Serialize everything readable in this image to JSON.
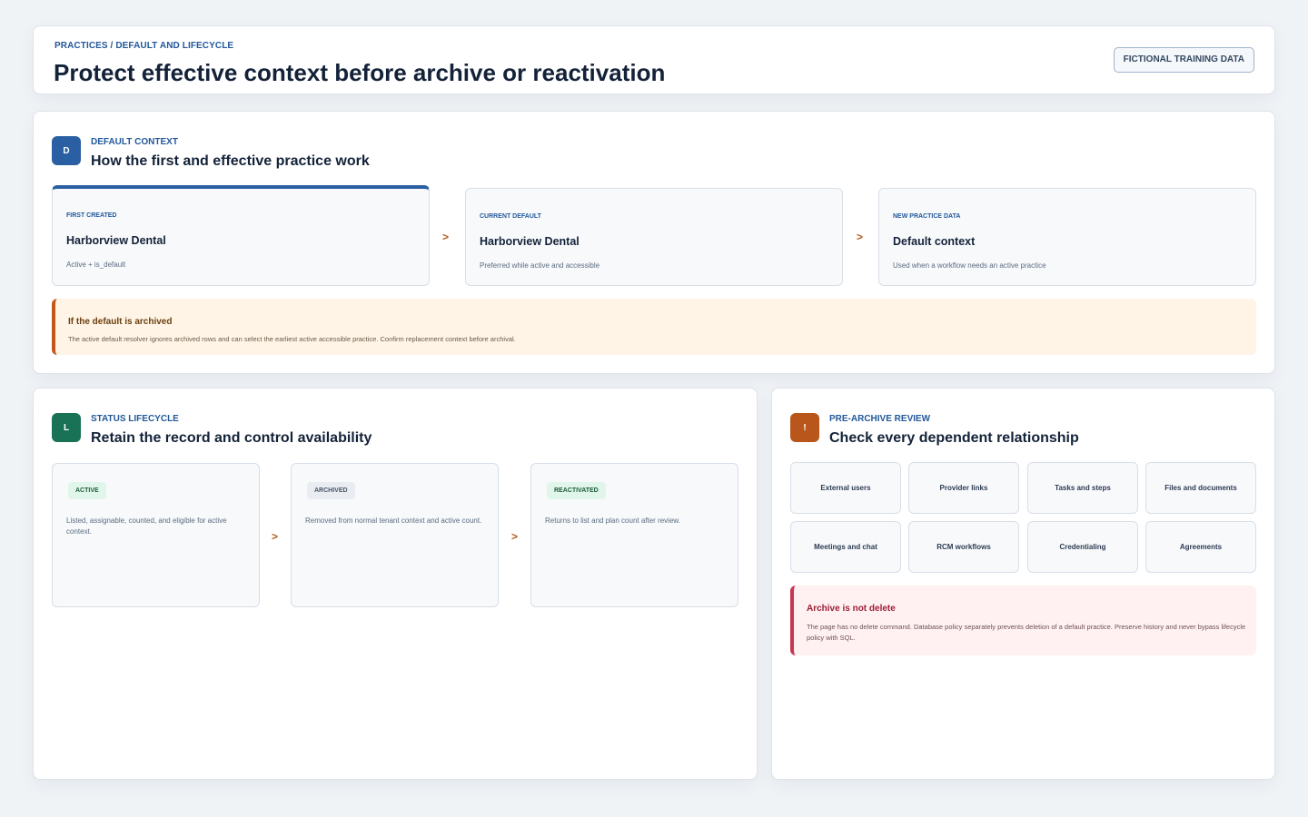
{
  "header": {
    "breadcrumb": "PRACTICES / DEFAULT AND LIFECYCLE",
    "title": "Protect effective context before archive or reactivation",
    "badge": "FICTIONAL TRAINING DATA"
  },
  "default_context": {
    "icon_letter": "D",
    "kicker": "DEFAULT CONTEXT",
    "title": "How the first and effective practice work",
    "steps": [
      {
        "kicker": "FIRST CREATED",
        "name": "Harborview Dental",
        "desc": "Active + is_default"
      },
      {
        "kicker": "CURRENT DEFAULT",
        "name": "Harborview Dental",
        "desc": "Preferred while active and accessible"
      },
      {
        "kicker": "NEW PRACTICE DATA",
        "name": "Default context",
        "desc": "Used when a workflow needs an active practice"
      }
    ],
    "arrow": ">",
    "warning": {
      "title": "If the default is archived",
      "text": "The active default resolver ignores archived rows and can select the earliest active accessible practice. Confirm replacement context before archival."
    }
  },
  "lifecycle": {
    "icon_letter": "L",
    "kicker": "STATUS LIFECYCLE",
    "title": "Retain the record and control availability",
    "stages": [
      {
        "label": "ACTIVE",
        "desc": "Listed, assignable, counted, and eligible for active context."
      },
      {
        "label": "ARCHIVED",
        "desc": "Removed from normal tenant context and active count."
      },
      {
        "label": "REACTIVATED",
        "desc": "Returns to list and plan count after review."
      }
    ],
    "arrow": ">"
  },
  "review": {
    "icon_letter": "!",
    "kicker": "PRE-ARCHIVE REVIEW",
    "title": "Check every dependent relationship",
    "dependencies": [
      "External users",
      "Provider links",
      "Tasks and steps",
      "Files and documents",
      "Meetings and chat",
      "RCM workflows",
      "Credentialing",
      "Agreements"
    ],
    "danger": {
      "title": "Archive is not delete",
      "text": "The page has no delete command. Database policy separately prevents deletion of a default practice. Preserve history and never bypass lifecycle policy with SQL."
    }
  },
  "colors": {
    "accent_blue": "#2a5fa3",
    "accent_green": "#1a7256",
    "accent_orange": "#b8561c",
    "warning_bg": "#fff4e6",
    "danger": "#c8364f"
  }
}
